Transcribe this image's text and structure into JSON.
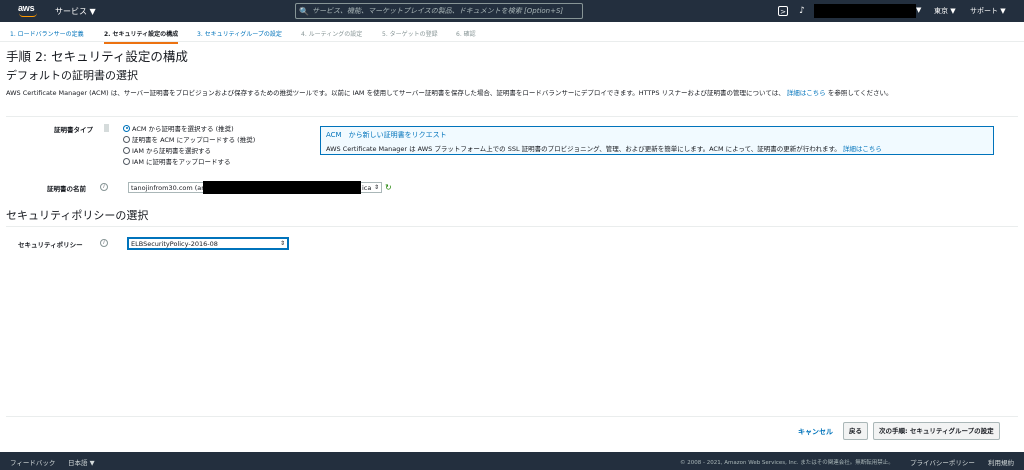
{
  "topnav": {
    "logo_text": "aws",
    "services_label": "サービス ▼",
    "search_icon": "🔍",
    "search_placeholder": "サービス、機能、マーケットプレイスの製品、ドキュメントを検索 [Option+S]",
    "terminal_icon": "⌨",
    "bell_icon": "🔔",
    "account_caret": "▼",
    "region_label": "東京 ▼",
    "support_label": "サポート ▼"
  },
  "steps": [
    {
      "label": "1. ロードバランサーの定義"
    },
    {
      "label": "2. セキュリティ設定の構成"
    },
    {
      "label": "3. セキュリティグループの設定"
    },
    {
      "label": "4. ルーティングの設定"
    },
    {
      "label": "5. ターゲットの登録"
    },
    {
      "label": "6. 確認"
    }
  ],
  "page_title": "手順 2: セキュリティ設定の構成",
  "section_default_cert": "デフォルトの証明書の選択",
  "description": {
    "text": "AWS Certificate Manager (ACM) は、サーバー証明書をプロビジョンおよび保存するための推奨ツールです。以前に IAM を使用してサーバー証明書を保存した場合、証明書をロードバランサーにデプロイできます。HTTPS リスナーおよび証明書の管理については、",
    "link": "詳細はこちら",
    "suffix": " を参照してください。"
  },
  "cert_type": {
    "label": "証明書タイプ",
    "options": [
      {
        "label": "ACM から証明書を選択する (推奨)",
        "selected": true
      },
      {
        "label": "証明書を ACM にアップロードする (推奨)",
        "selected": false
      },
      {
        "label": "IAM から証明書を選択する",
        "selected": false
      },
      {
        "label": "IAM に証明書をアップロードする",
        "selected": false
      }
    ]
  },
  "infobox": {
    "title": "ACM　から新しい証明書をリクエスト",
    "body": "AWS Certificate Manager は AWS プラットフォーム上での SSL 証明書のプロビジョニング、管理、および更新を簡単にします。ACM によって、証明書の更新が行われます。",
    "link": "詳細はこちら"
  },
  "cert_name": {
    "label": "証明書の名前",
    "info": "i",
    "value_prefix": "tanojinfrom30.com (ar",
    "value_suffix": "ica",
    "arrow": "⇕",
    "refresh_icon": "↻"
  },
  "section_security_policy": "セキュリティポリシーの選択",
  "security_policy": {
    "label": "セキュリティポリシー",
    "info": "i",
    "value": "ELBSecurityPolicy-2016-08",
    "arrow": "⇕"
  },
  "actions": {
    "cancel": "キャンセル",
    "back": "戻る",
    "next": "次の手順: セキュリティグループの設定"
  },
  "footer": {
    "feedback": "フィードバック",
    "language": "日本語 ▼",
    "copyright": "© 2008 - 2021, Amazon Web Services, Inc. またはその関連会社。無断転用禁止。",
    "privacy": "プライバシーポリシー",
    "terms": "利用規約"
  }
}
